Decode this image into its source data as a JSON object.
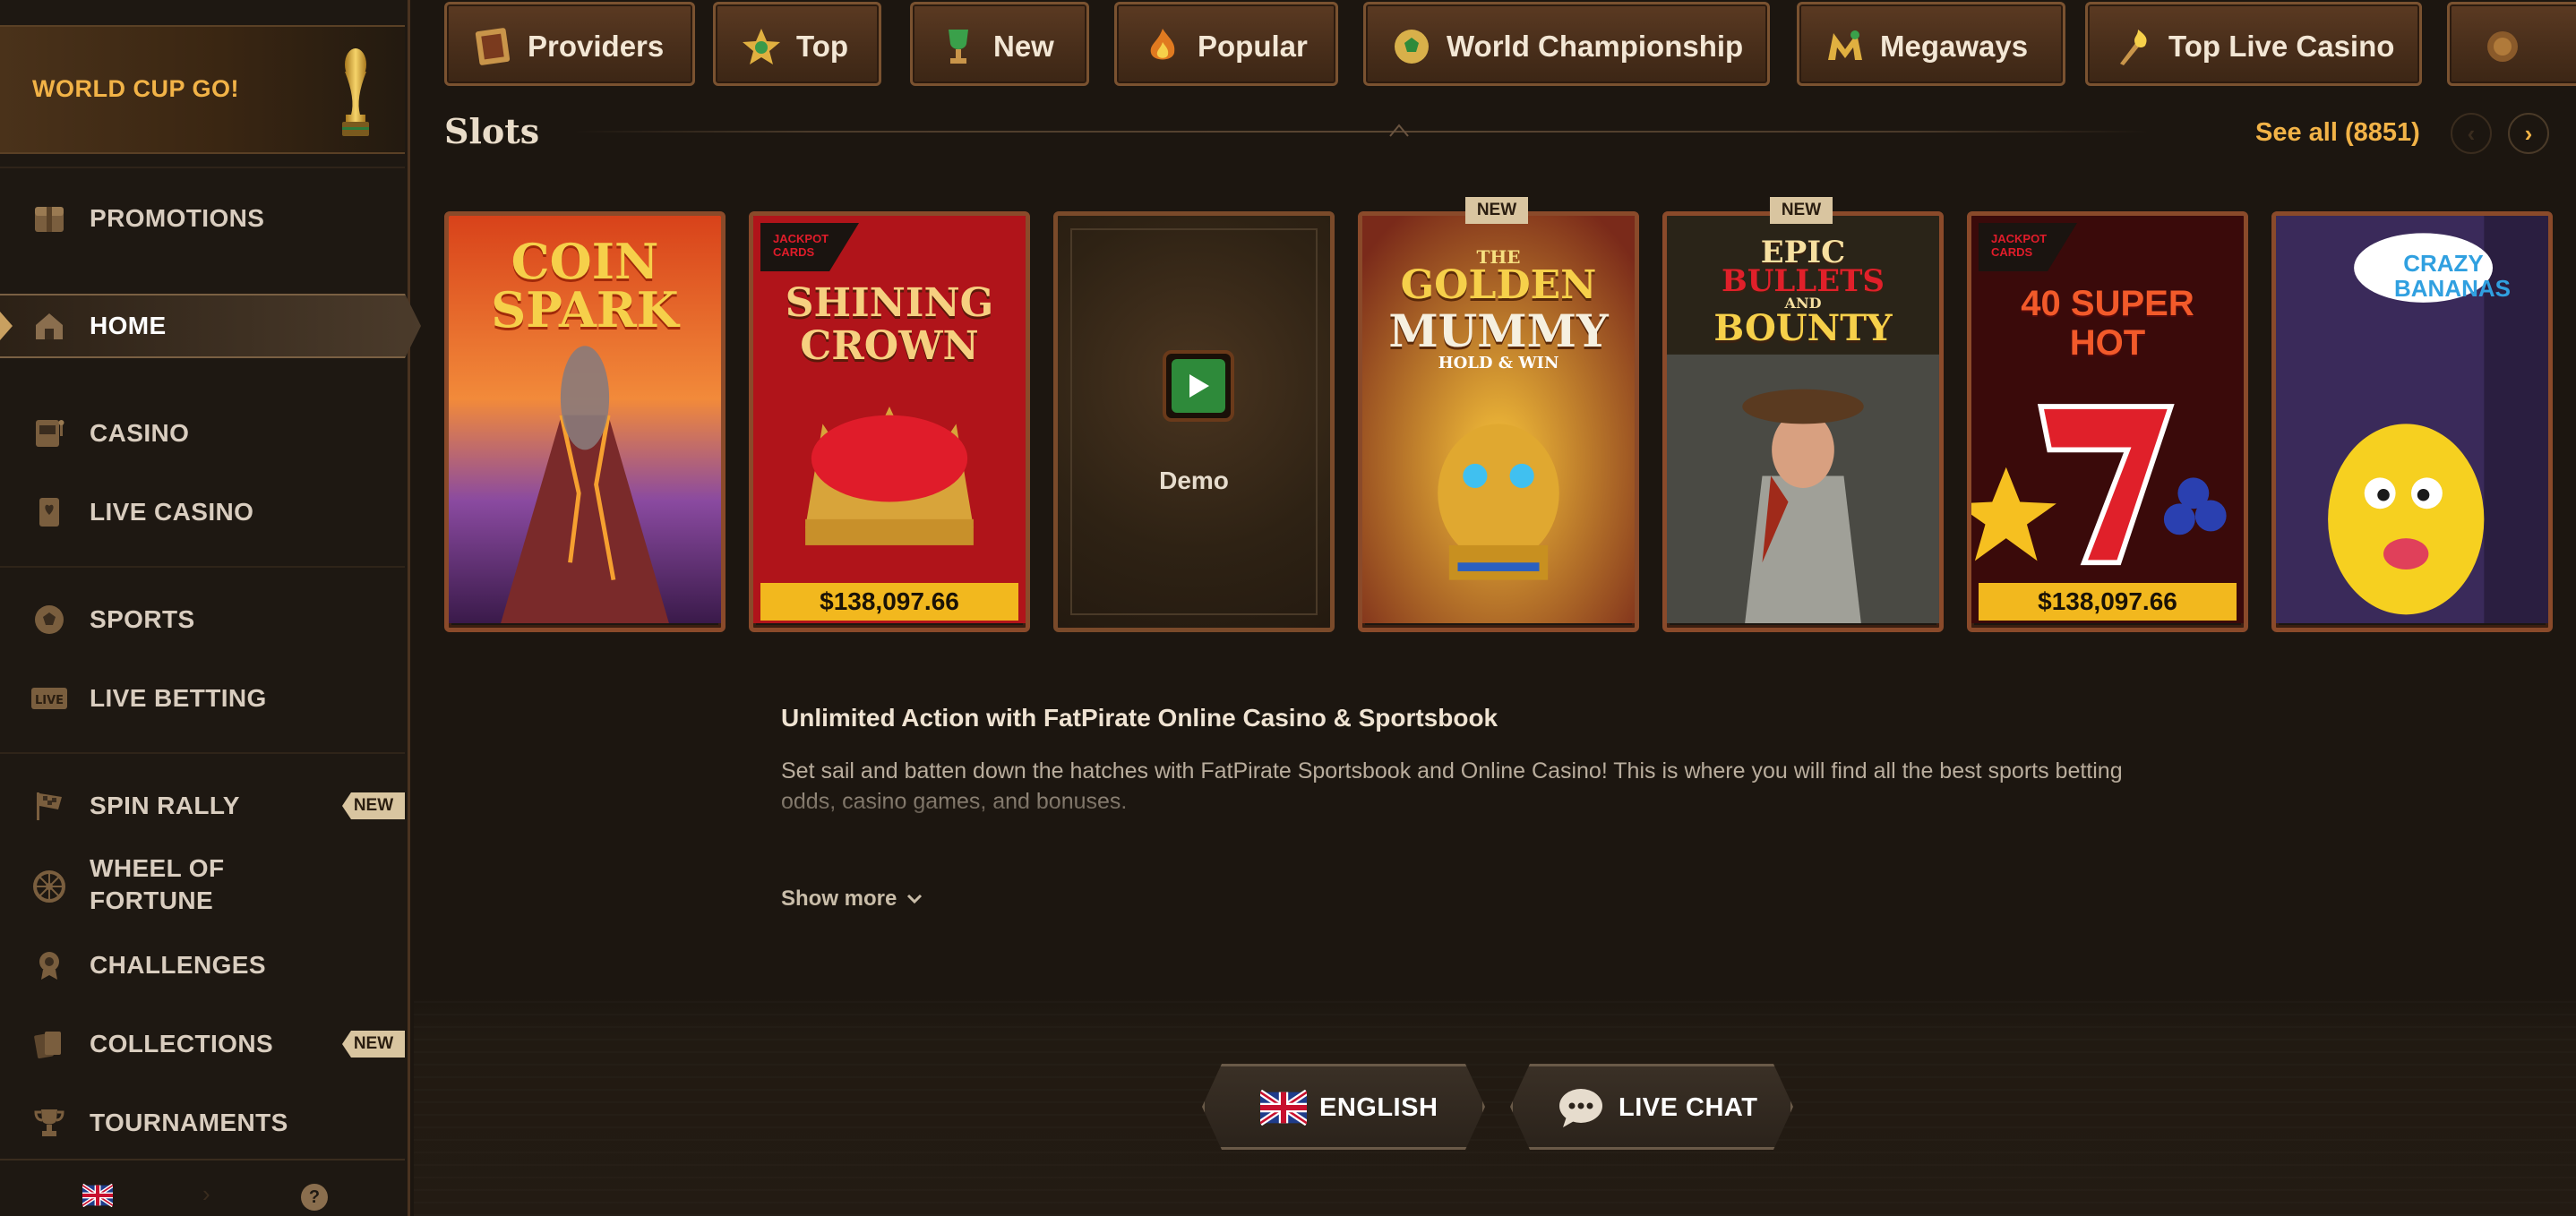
{
  "sidebar": {
    "promo_label": "WORLD CUP GO!",
    "items": [
      {
        "label": "PROMOTIONS",
        "icon": "gift-chest-icon"
      },
      {
        "label": "HOME",
        "icon": "home-icon"
      },
      {
        "label": "CASINO",
        "icon": "slot-machine-icon"
      },
      {
        "label": "LIVE CASINO",
        "icon": "playing-card-icon"
      },
      {
        "label": "SPORTS",
        "icon": "soccer-ball-icon"
      },
      {
        "label": "LIVE BETTING",
        "icon": "live-icon",
        "icon_text": "LIVE"
      },
      {
        "label": "SPIN RALLY",
        "icon": "checkered-flag-icon",
        "badge": "NEW"
      },
      {
        "label": "WHEEL OF",
        "label2": "FORTUNE",
        "icon": "wheel-icon"
      },
      {
        "label": "CHALLENGES",
        "icon": "medal-icon"
      },
      {
        "label": "COLLECTIONS",
        "icon": "cards-icon",
        "badge": "NEW"
      },
      {
        "label": "TOURNAMENTS",
        "icon": "trophy-icon"
      }
    ],
    "help_glyph": "?"
  },
  "tabs": [
    {
      "label": "Providers",
      "icon": "providers-icon"
    },
    {
      "label": "Top",
      "icon": "star-icon"
    },
    {
      "label": "New",
      "icon": "new-cup-icon"
    },
    {
      "label": "Popular",
      "icon": "fire-icon"
    },
    {
      "label": "World Championship",
      "icon": "soccer-ball-icon"
    },
    {
      "label": "Megaways",
      "icon": "megaways-icon"
    },
    {
      "label": "Top Live Casino",
      "icon": "torch-icon"
    }
  ],
  "slots": {
    "title": "Slots",
    "see_all": "See all (8851)",
    "prev": "‹",
    "next": "›",
    "games": [
      {
        "title_l1": "COIN",
        "title_l2": "SPARK"
      },
      {
        "title_l1": "SHINING",
        "title_l2": "CROWN",
        "brand": "JACKPOT CARDS",
        "jackpot": "$138,097.66"
      },
      {
        "demo_label": "Demo"
      },
      {
        "title_l0": "THE",
        "title_l1": "GOLDEN",
        "title_l2": "MUMMY",
        "subtitle": "HOLD & WIN",
        "badge": "NEW"
      },
      {
        "title_l1": "EPIC",
        "title_l2": "BULLETS",
        "title_l3": "AND",
        "title_l4": "BOUNTY",
        "badge": "NEW"
      },
      {
        "title_l1": "40 SUPER",
        "title_l2": "HOT",
        "brand": "JACKPOT CARDS",
        "jackpot": "$138,097.66"
      },
      {
        "title_l1": "CRAZY",
        "title_l2": "BANANAS"
      }
    ]
  },
  "seo": {
    "title": "Unlimited Action with FatPirate Online Casino & Sportsbook",
    "text": "Set sail and batten down the hatches with FatPirate Sportsbook and Online Casino! This is where you will find all the best sports betting odds, casino games, and bonuses.",
    "show_more": "Show more"
  },
  "footer": {
    "language": "ENGLISH",
    "live_chat": "LIVE CHAT"
  },
  "colors": {
    "accent": "#f2b347",
    "jackpot": "#f2b81e",
    "frame": "#8a4a2a",
    "background": "#1c1610"
  }
}
